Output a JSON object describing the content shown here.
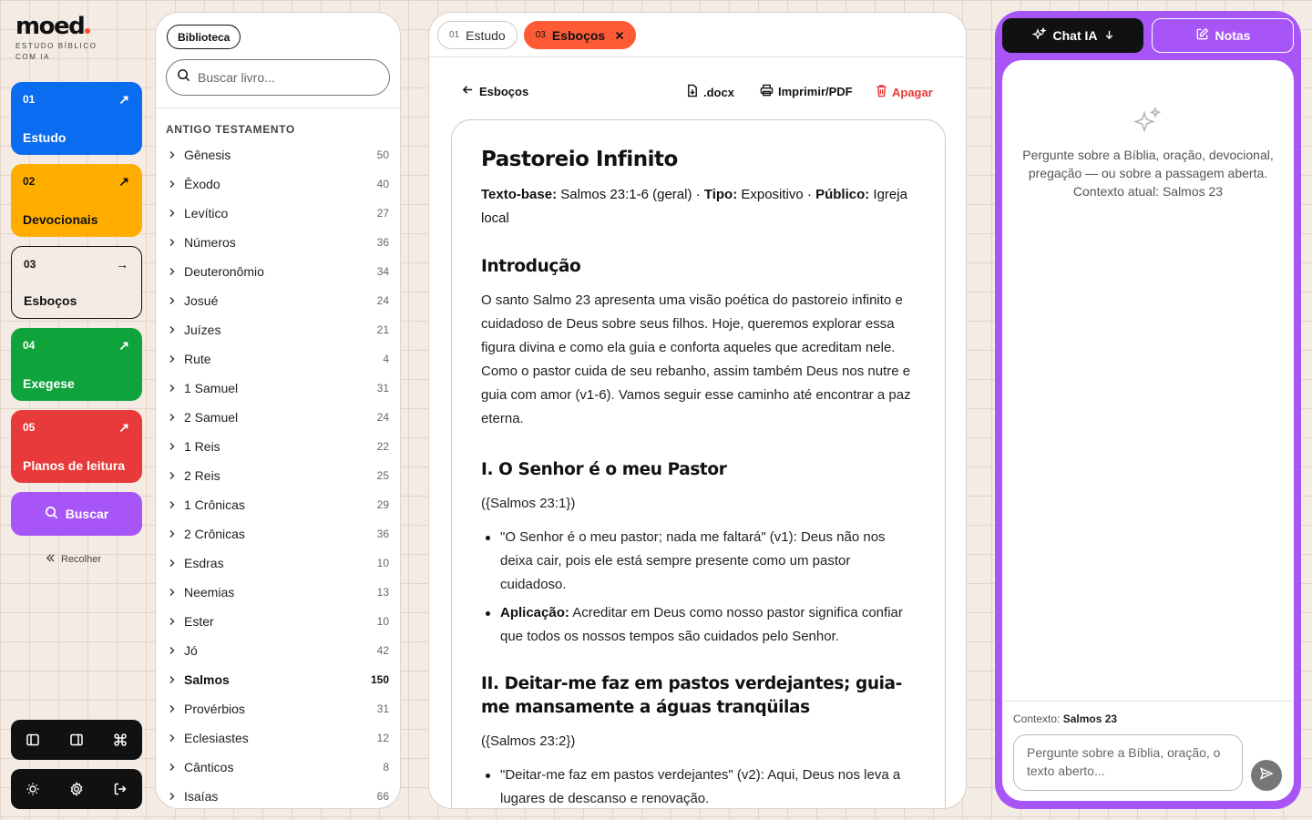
{
  "brand": {
    "name": "moed",
    "tagline": "ESTUDO BÍBLICO COM IA",
    "dot_color": "#ff4d2e"
  },
  "nav": {
    "items": [
      {
        "num": "01",
        "label": "Estudo",
        "color": "#0a6cf0",
        "arrow": "↗"
      },
      {
        "num": "02",
        "label": "Devocionais",
        "color": "#ffae00",
        "arrow": "↗"
      },
      {
        "num": "03",
        "label": "Esboços",
        "color": "outline",
        "arrow": "→"
      },
      {
        "num": "04",
        "label": "Exegese",
        "color": "#0fa33c",
        "arrow": "↗"
      },
      {
        "num": "05",
        "label": "Planos de leitura",
        "color": "#e83a3a",
        "arrow": "↗"
      }
    ],
    "search_label": "Buscar",
    "collapse_label": "Recolher"
  },
  "library": {
    "pill_label": "Biblioteca",
    "search_placeholder": "Buscar livro...",
    "section_title": "ANTIGO TESTAMENTO",
    "books": [
      {
        "name": "Gênesis",
        "chapters": "50"
      },
      {
        "name": "Êxodo",
        "chapters": "40"
      },
      {
        "name": "Levítico",
        "chapters": "27"
      },
      {
        "name": "Números",
        "chapters": "36"
      },
      {
        "name": "Deuteronômio",
        "chapters": "34"
      },
      {
        "name": "Josué",
        "chapters": "24"
      },
      {
        "name": "Juízes",
        "chapters": "21"
      },
      {
        "name": "Rute",
        "chapters": "4"
      },
      {
        "name": "1 Samuel",
        "chapters": "31"
      },
      {
        "name": "2 Samuel",
        "chapters": "24"
      },
      {
        "name": "1 Reis",
        "chapters": "22"
      },
      {
        "name": "2 Reis",
        "chapters": "25"
      },
      {
        "name": "1 Crônicas",
        "chapters": "29"
      },
      {
        "name": "2 Crônicas",
        "chapters": "36"
      },
      {
        "name": "Esdras",
        "chapters": "10"
      },
      {
        "name": "Neemias",
        "chapters": "13"
      },
      {
        "name": "Ester",
        "chapters": "10"
      },
      {
        "name": "Jó",
        "chapters": "42"
      },
      {
        "name": "Salmos",
        "chapters": "150",
        "active": true
      },
      {
        "name": "Provérbios",
        "chapters": "31"
      },
      {
        "name": "Eclesiastes",
        "chapters": "12"
      },
      {
        "name": "Cânticos",
        "chapters": "8"
      },
      {
        "name": "Isaías",
        "chapters": "66"
      }
    ]
  },
  "tabs": [
    {
      "num": "01",
      "label": "Estudo",
      "active": false
    },
    {
      "num": "03",
      "label": "Esboços",
      "active": true
    }
  ],
  "toolbar": {
    "back_label": "Esboços",
    "docx_label": ".docx",
    "print_label": "Imprimir/PDF",
    "delete_label": "Apagar"
  },
  "document": {
    "title": "Pastoreio Infinito",
    "meta": {
      "base_label": "Texto-base:",
      "base_value": " Salmos 23:1-6 (geral) · ",
      "type_label": "Tipo:",
      "type_value": " Expositivo · ",
      "audience_label": "Público:",
      "audience_value": " Igreja local"
    },
    "intro_heading": "Introdução",
    "intro_text": "O santo Salmo 23 apresenta uma visão poética do pastoreio infinito e cuidadoso de Deus sobre seus filhos. Hoje, queremos explorar essa figura divina e como ela guia e conforta aqueles que acreditam nele. Como o pastor cuida de seu rebanho, assim também Deus nos nutre e guia com amor (v1-6). Vamos seguir esse caminho até encontrar a paz eterna.",
    "sections": [
      {
        "heading": "I. O Senhor é o meu Pastor",
        "ref": "({Salmos 23:1})",
        "bullets": [
          {
            "bold": "",
            "text": "\"O Senhor é o meu pastor; nada me faltará\" (v1): Deus não nos deixa cair, pois ele está sempre presente como um pastor cuidadoso."
          },
          {
            "bold": "Aplicação:",
            "text": " Acreditar em Deus como nosso pastor significa confiar que todos os nossos tempos são cuidados pelo Senhor."
          }
        ]
      },
      {
        "heading": "II. Deitar-me faz em pastos verdejantes; guia-me mansamente a águas tranqüilas",
        "ref": "({Salmos 23:2})",
        "bullets": [
          {
            "bold": "",
            "text": "\"Deitar-me faz em pastos verdejantes\" (v2): Aqui, Deus nos leva a lugares de descanso e renovação."
          }
        ]
      }
    ]
  },
  "chat": {
    "tab_chat_label": "Chat IA",
    "tab_notes_label": "Notas",
    "empty_text": "Pergunte sobre a Bíblia, oração, devocional, pregação — ou sobre a passagem aberta. Contexto atual: Salmos 23",
    "context_label": "Contexto:",
    "context_value": "Salmos 23",
    "input_placeholder": "Pergunte sobre a Bíblia, oração, o texto aberto...",
    "accent": "#a855f7"
  }
}
